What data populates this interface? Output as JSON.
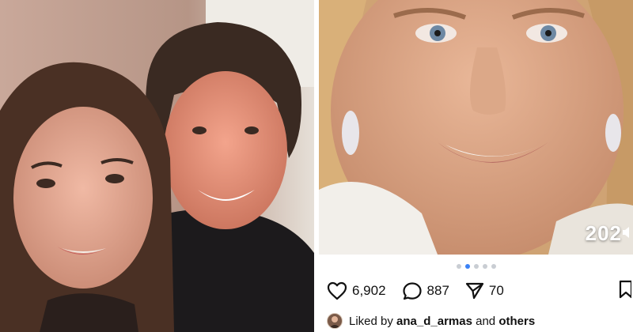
{
  "post": {
    "likes": "6,902",
    "comments": "887",
    "shares": "70",
    "liked_prefix": "Liked by",
    "liked_user": "ana_d_armas",
    "liked_and": "and",
    "liked_others": "others",
    "overlay_year": "202",
    "carousel": {
      "total": 5,
      "active_index": 1
    }
  },
  "icons": {
    "like": "heart-icon",
    "comment": "comment-icon",
    "share": "send-icon",
    "save": "bookmark-icon",
    "sound": "speaker-icon"
  },
  "colors": {
    "carousel_active": "#3b82f6",
    "carousel_inactive": "#c9cdd3",
    "text": "#111111"
  }
}
